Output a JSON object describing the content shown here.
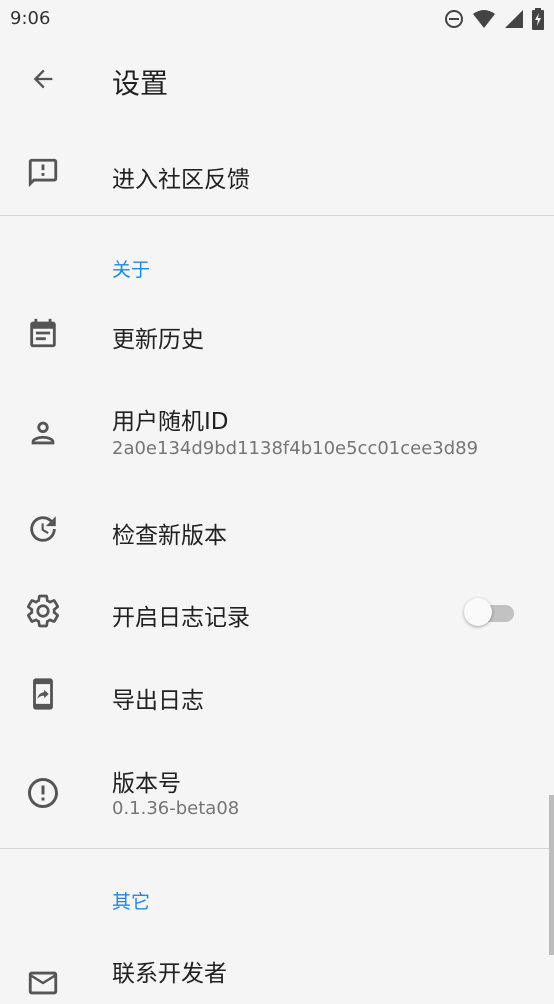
{
  "status_bar": {
    "time": "9:06",
    "icons": [
      "do-not-disturb-icon",
      "wifi-icon",
      "signal-icon",
      "battery-charging-icon"
    ]
  },
  "app_bar": {
    "title": "设置",
    "back_icon": "arrow-back-icon"
  },
  "items": {
    "feedback": {
      "title": "进入社区反馈",
      "icon": "feedback-icon"
    },
    "about_header": "关于",
    "changelog": {
      "title": "更新历史",
      "icon": "calendar-icon"
    },
    "user_id": {
      "title": "用户随机ID",
      "value": "2a0e134d9bd1138f4b10e5cc01cee3d89",
      "icon": "person-icon"
    },
    "check_update": {
      "title": "检查新版本",
      "icon": "update-icon"
    },
    "logging": {
      "title": "开启日志记录",
      "icon": "settings-gear-icon",
      "enabled": false
    },
    "export_logs": {
      "title": "导出日志",
      "icon": "share-phone-icon"
    },
    "version": {
      "title": "版本号",
      "value": "0.1.36-beta08",
      "icon": "info-alert-icon"
    },
    "other_header": "其它",
    "contact": {
      "title": "联系开发者",
      "icon": "mail-icon"
    }
  },
  "colors": {
    "accent": "#1e88e5",
    "background": "#f5f5f5",
    "icon": "#555555",
    "subtitle": "#757575"
  }
}
